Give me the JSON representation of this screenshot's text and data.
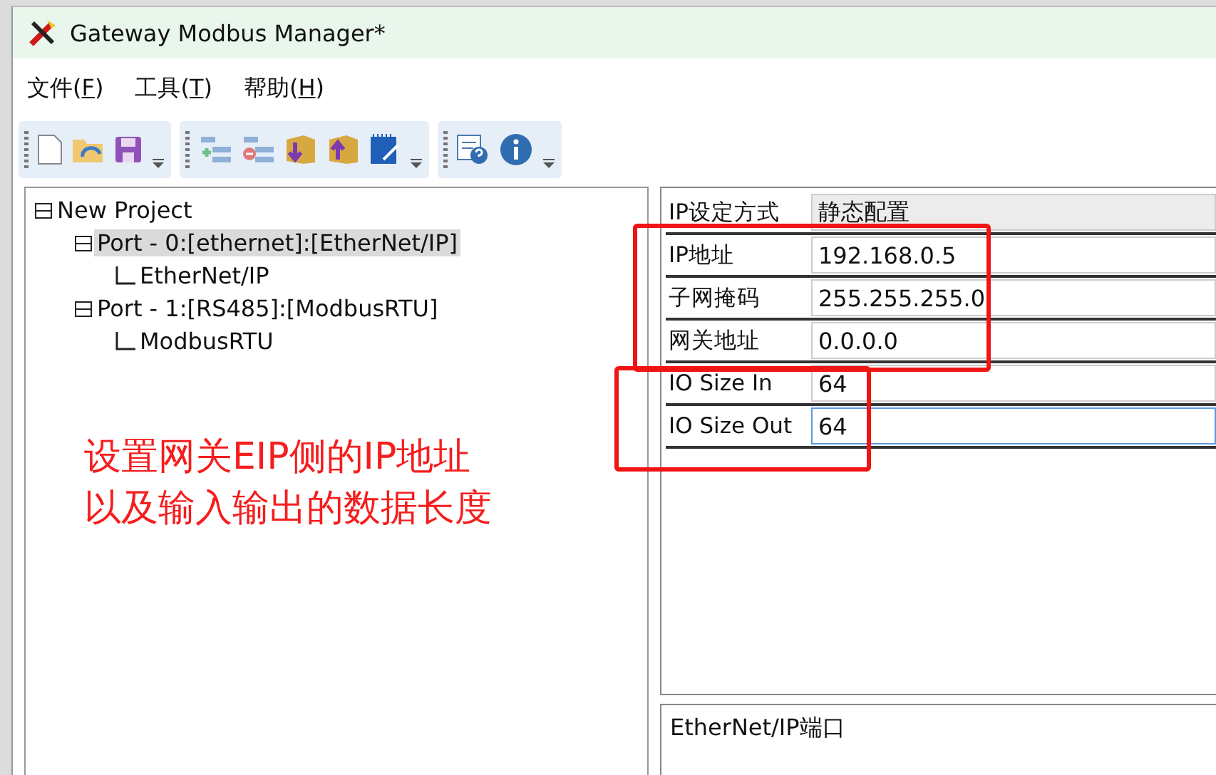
{
  "window": {
    "title": "Gateway Modbus Manager*"
  },
  "menu": [
    {
      "label": "文件(",
      "key": "F",
      "tail": ")"
    },
    {
      "label": "工具(",
      "key": "T",
      "tail": ")"
    },
    {
      "label": "帮助(",
      "key": "H",
      "tail": ")"
    }
  ],
  "toolbars": [
    {
      "buttons": [
        {
          "kind": "new-file"
        },
        {
          "kind": "open-folder"
        },
        {
          "kind": "save"
        }
      ]
    },
    {
      "buttons": [
        {
          "kind": "add-node"
        },
        {
          "kind": "remove-node"
        },
        {
          "kind": "download"
        },
        {
          "kind": "upload"
        },
        {
          "kind": "notepad"
        }
      ]
    },
    {
      "buttons": [
        {
          "kind": "help-doc"
        },
        {
          "kind": "info"
        }
      ]
    }
  ],
  "tree": [
    {
      "label": "New Project",
      "expanded": true,
      "selected": false,
      "children": [
        {
          "label": "Port - 0:[ethernet]:[EtherNet/IP]",
          "expanded": true,
          "selected": true,
          "children": [
            {
              "label": "EtherNet/IP",
              "selected": false
            }
          ]
        },
        {
          "label": "Port - 1:[RS485]:[ModbusRTU]",
          "expanded": true,
          "selected": false,
          "children": [
            {
              "label": "ModbusRTU",
              "selected": false
            }
          ]
        }
      ]
    }
  ],
  "properties": [
    {
      "name": "IP设定方式",
      "value": "静态配置",
      "kind": "select",
      "selected": false
    },
    {
      "name": "IP地址",
      "value": "192.168.0.5",
      "kind": "text",
      "selected": false
    },
    {
      "name": "子网掩码",
      "value": "255.255.255.0",
      "kind": "text",
      "selected": false
    },
    {
      "name": "网关地址",
      "value": "0.0.0.0",
      "kind": "text",
      "selected": false
    },
    {
      "name": "IO Size In",
      "value": "64",
      "kind": "text",
      "selected": false
    },
    {
      "name": "IO Size Out",
      "value": "64",
      "kind": "text",
      "selected": true
    }
  ],
  "description": "EtherNet/IP端口",
  "annotation": {
    "lines": [
      "设置网关EIP侧的IP地址",
      "以及输入输出的数据长度"
    ]
  }
}
